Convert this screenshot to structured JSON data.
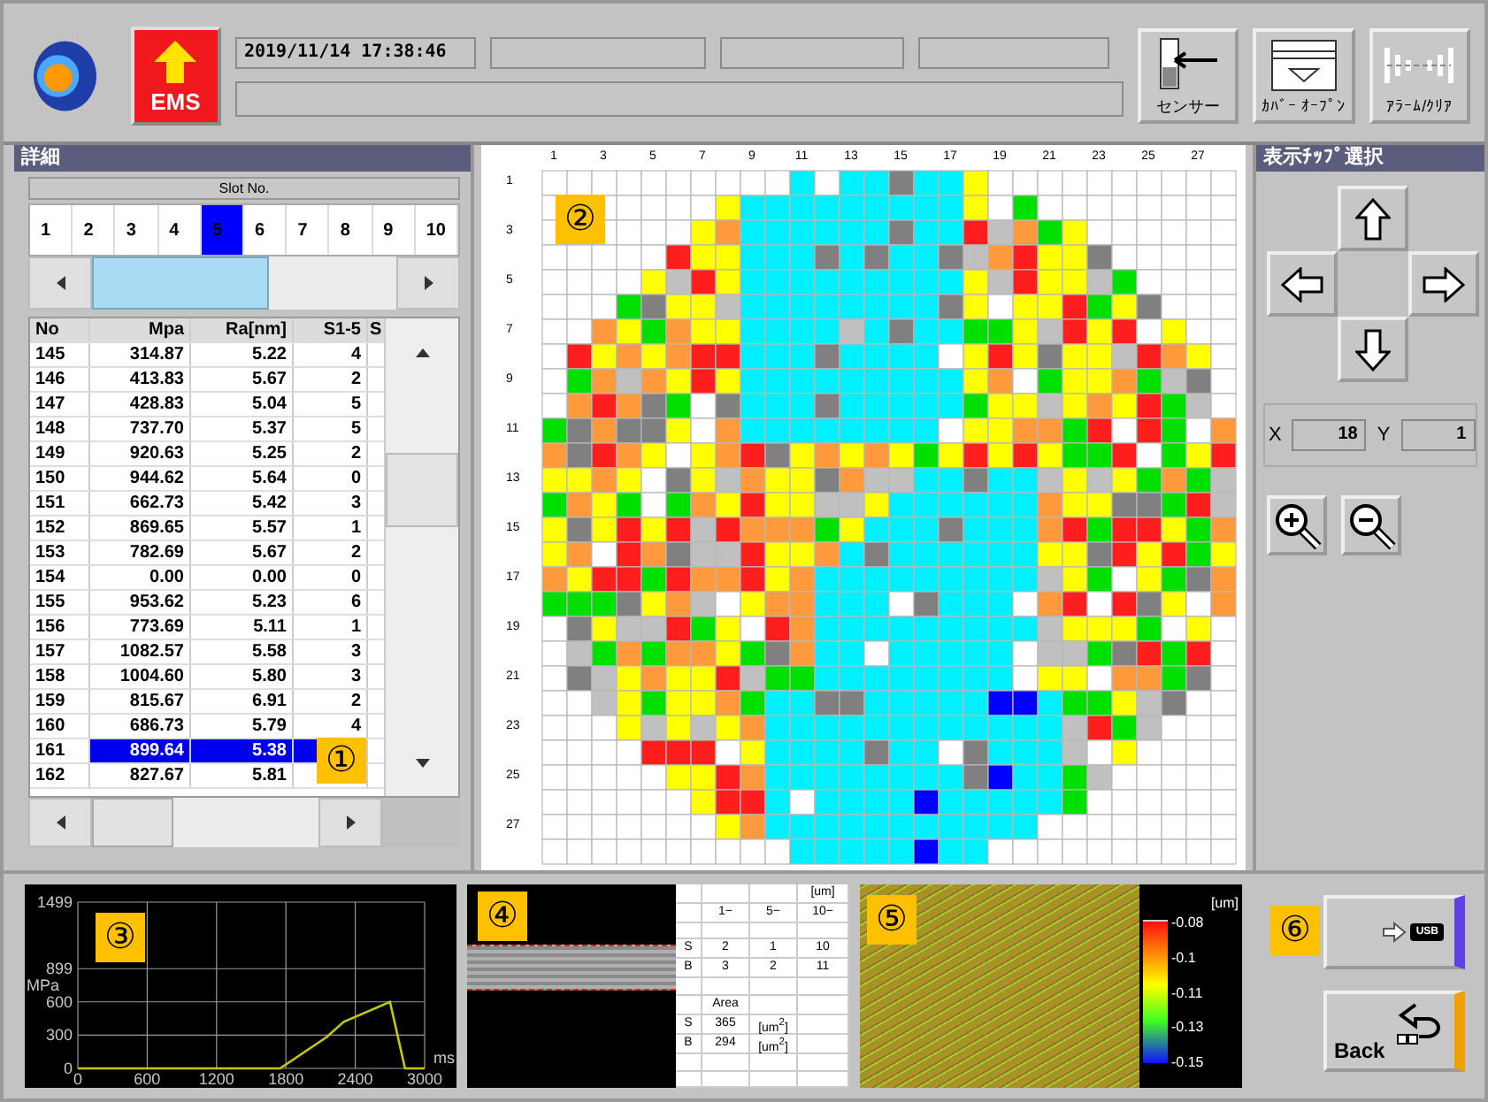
{
  "top_bar": {
    "ems_label": "EMS",
    "datetime": "2019/11/14 17:38:46",
    "buttons": [
      {
        "kind": "sensor",
        "label": "センサー"
      },
      {
        "kind": "cover",
        "label": "ｶﾊﾞｰ ｵｰﾌﾟﾝ"
      },
      {
        "kind": "alarm",
        "label": "ｱﾗｰﾑ/ｸﾘｱ"
      }
    ]
  },
  "detail_panel": {
    "title": "詳細",
    "slot_header": "Slot No.",
    "marker": "①",
    "slots": [
      {
        "label": "1",
        "selected": false
      },
      {
        "label": "2",
        "selected": false
      },
      {
        "label": "3",
        "selected": false
      },
      {
        "label": "4",
        "selected": false
      },
      {
        "label": "5",
        "selected": true
      },
      {
        "label": "6",
        "selected": false
      },
      {
        "label": "7",
        "selected": false
      },
      {
        "label": "8",
        "selected": false
      },
      {
        "label": "9",
        "selected": false
      },
      {
        "label": "10",
        "selected": false
      }
    ],
    "table": {
      "columns": [
        "No",
        "Mpa",
        "Ra[nm]",
        "S1-5",
        "S"
      ],
      "rows": [
        {
          "no": "145",
          "mpa": "314.87",
          "ra": "5.22",
          "s15": "4",
          "selected": false
        },
        {
          "no": "146",
          "mpa": "413.83",
          "ra": "5.67",
          "s15": "2",
          "selected": false
        },
        {
          "no": "147",
          "mpa": "428.83",
          "ra": "5.04",
          "s15": "5",
          "selected": false
        },
        {
          "no": "148",
          "mpa": "737.70",
          "ra": "5.37",
          "s15": "5",
          "selected": false
        },
        {
          "no": "149",
          "mpa": "920.63",
          "ra": "5.25",
          "s15": "2",
          "selected": false
        },
        {
          "no": "150",
          "mpa": "944.62",
          "ra": "5.64",
          "s15": "0",
          "selected": false
        },
        {
          "no": "151",
          "mpa": "662.73",
          "ra": "5.42",
          "s15": "3",
          "selected": false
        },
        {
          "no": "152",
          "mpa": "869.65",
          "ra": "5.57",
          "s15": "1",
          "selected": false
        },
        {
          "no": "153",
          "mpa": "782.69",
          "ra": "5.67",
          "s15": "2",
          "selected": false
        },
        {
          "no": "154",
          "mpa": "0.00",
          "ra": "0.00",
          "s15": "0",
          "selected": false
        },
        {
          "no": "155",
          "mpa": "953.62",
          "ra": "5.23",
          "s15": "6",
          "selected": false
        },
        {
          "no": "156",
          "mpa": "773.69",
          "ra": "5.11",
          "s15": "1",
          "selected": false
        },
        {
          "no": "157",
          "mpa": "1082.57",
          "ra": "5.58",
          "s15": "3",
          "selected": false
        },
        {
          "no": "158",
          "mpa": "1004.60",
          "ra": "5.80",
          "s15": "3",
          "selected": false
        },
        {
          "no": "159",
          "mpa": "815.67",
          "ra": "6.91",
          "s15": "2",
          "selected": false
        },
        {
          "no": "160",
          "mpa": "686.73",
          "ra": "5.79",
          "s15": "4",
          "selected": false
        },
        {
          "no": "161",
          "mpa": "899.64",
          "ra": "5.38",
          "selected": true
        },
        {
          "no": "162",
          "mpa": "827.67",
          "ra": "5.81",
          "selected": false
        }
      ]
    }
  },
  "wafer_map": {
    "marker": "②",
    "column_labels": [
      "1",
      "3",
      "5",
      "7",
      "9",
      "11",
      "13",
      "15",
      "17",
      "19",
      "21",
      "23",
      "25",
      "27"
    ],
    "row_labels": [
      "1",
      "3",
      "5",
      "7",
      "9",
      "11",
      "13",
      "15",
      "17",
      "19",
      "21",
      "23",
      "25",
      "27"
    ]
  },
  "chip_panel": {
    "title": "表示ﾁｯﾌﾟ選択",
    "x_label": "X",
    "x_value": "18",
    "y_label": "Y",
    "y_value": "1"
  },
  "force_chart": {
    "marker": "③",
    "chart_data": {
      "type": "line",
      "xlabel": "ms",
      "ylabel": "MPa",
      "xlim": [
        0,
        3000
      ],
      "ylim": [
        0,
        1499
      ],
      "xticks": [
        0,
        600,
        1200,
        1800,
        2400,
        3000
      ],
      "yticks": [
        0,
        300,
        600,
        899,
        1499
      ],
      "grid": true,
      "x": [
        0,
        1750,
        2150,
        2300,
        2700,
        2830,
        3000
      ],
      "series": [
        {
          "color": "#c8c800",
          "values": [
            0,
            0,
            280,
            420,
            600,
            0,
            0
          ]
        }
      ]
    }
  },
  "cross_section": {
    "marker": "④",
    "table": [
      {
        "kind": "data",
        "c3": "[um]"
      },
      {
        "kind": "data",
        "c1": "1−",
        "c2": "5−",
        "c3": "10−"
      },
      {
        "kind": "blank"
      },
      {
        "kind": "data",
        "c0": "S",
        "c1": "2",
        "c2": "1",
        "c3": "10"
      },
      {
        "kind": "data",
        "c0": "B",
        "c1": "3",
        "c2": "2",
        "c3": "11"
      },
      {
        "kind": "blank"
      },
      {
        "kind": "data",
        "c1": "Area"
      },
      {
        "kind": "data",
        "c0": "S",
        "c1": "365",
        "c2": "[um$^{2}$]"
      },
      {
        "kind": "data",
        "c0": "B",
        "c1": "294",
        "c2": "[um$^{2}$]"
      },
      {
        "kind": "blank"
      },
      {
        "kind": "blank"
      }
    ]
  },
  "surface": {
    "marker": "⑤",
    "unit": "[um]",
    "ticks": [
      "-0.08",
      "-0.1",
      "-0.11",
      "-0.13",
      "-0.15"
    ]
  },
  "actions": {
    "usb_marker": "⑥",
    "usb_label": "USB",
    "back_label": "Back"
  }
}
